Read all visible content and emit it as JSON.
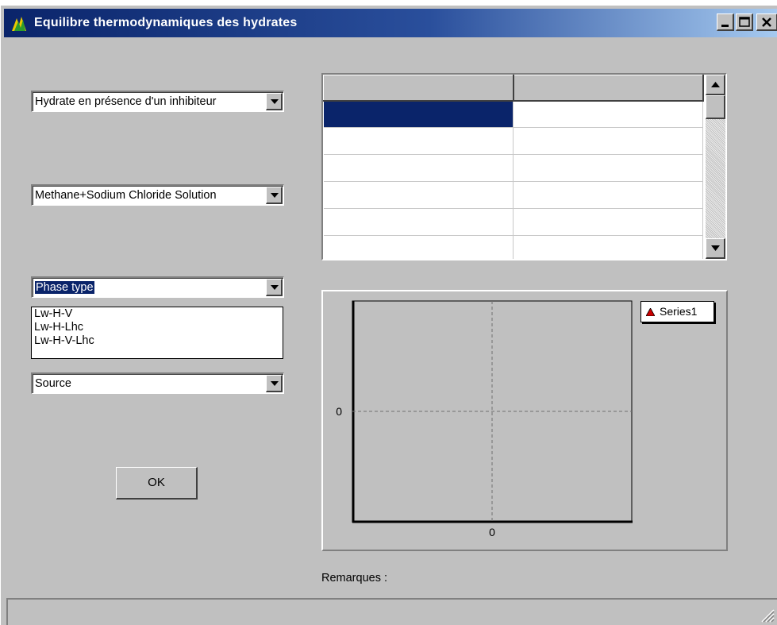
{
  "window": {
    "title": "Equilibre thermodynamiques des hydrates",
    "controls": [
      "minimize-icon",
      "maximize-icon",
      "close-icon"
    ]
  },
  "left_panel": {
    "hydrate_type": {
      "value": "Hydrate en présence d'un inhibiteur"
    },
    "system": {
      "value": "Methane+Sodium Chloride Solution"
    },
    "phase_type": {
      "value": "Phase type",
      "options": [
        "Lw-H-V",
        "Lw-H-Lhc",
        "Lw-H-V-Lhc"
      ]
    },
    "source": {
      "value": "Source"
    },
    "ok_label": "OK"
  },
  "grid": {
    "columns": [
      "",
      ""
    ],
    "rows": [
      [
        "",
        ""
      ],
      [
        "",
        ""
      ],
      [
        "",
        ""
      ],
      [
        "",
        ""
      ],
      [
        "",
        ""
      ],
      [
        "",
        ""
      ]
    ],
    "selection_color": "#0a246a"
  },
  "chart_data": {
    "type": "scatter",
    "title": "",
    "xlabel": "",
    "ylabel": "",
    "x_ticks": [
      "0"
    ],
    "y_ticks": [
      "0"
    ],
    "grid": true,
    "legend_position": "top-right",
    "series": [
      {
        "name": "Series1",
        "values": [],
        "marker": "triangle",
        "color": "#cc0000"
      }
    ]
  },
  "remarks_label": "Remarques :",
  "colors": {
    "face": "#c0c0c0",
    "title_start": "#0a246a",
    "title_end": "#a6caf0",
    "selection": "#0a246a"
  }
}
